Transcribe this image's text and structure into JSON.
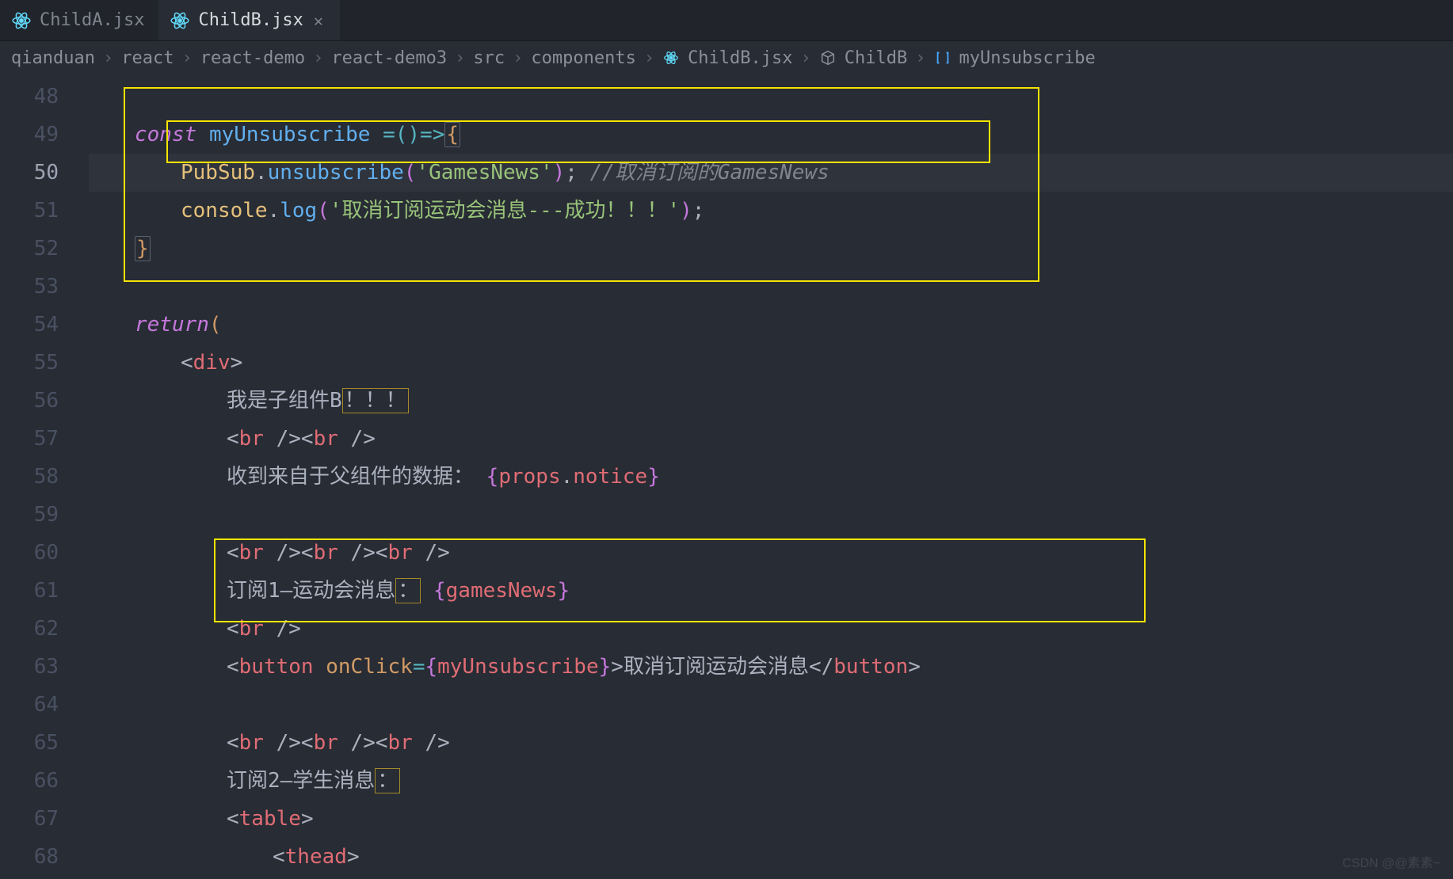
{
  "tabs": [
    {
      "label": "ChildA.jsx",
      "active": false
    },
    {
      "label": "ChildB.jsx",
      "active": true
    }
  ],
  "breadcrumbs": {
    "parts": [
      "qianduan",
      "react",
      "react-demo",
      "react-demo3",
      "src",
      "components"
    ],
    "file": "ChildB.jsx",
    "symbol1": "ChildB",
    "symbol2": "myUnsubscribe"
  },
  "gutter": {
    "start": 48,
    "end": 68,
    "current": 50
  },
  "code": {
    "l49_const": "const",
    "l49_name": "myUnsubscribe",
    "l49_arrow": "=()=>",
    "l50_obj": "PubSub",
    "l50_method": "unsubscribe",
    "l50_arg": "'GamesNews'",
    "l50_cmt": "//取消订阅的GamesNews",
    "l51_obj": "console",
    "l51_method": "log",
    "l51_arg": "'取消订阅运动会消息---成功！！！'",
    "l54_return": "return",
    "l55_tag": "div",
    "l56_text_a": "我是子组件B",
    "l56_text_b": "！！！",
    "l57_tag": "br",
    "l58_text": "收到来自于父组件的数据：",
    "l58_expr_a": "props",
    "l58_expr_b": "notice",
    "l60_tag": "br",
    "l61_text_a": "订阅1—运动会消息",
    "l61_text_b": "：",
    "l61_expr": "gamesNews",
    "l62_tag": "br",
    "l63_tag": "button",
    "l63_attr": "onClick",
    "l63_expr": "myUnsubscribe",
    "l63_inner": "取消订阅运动会消息",
    "l65_tag": "br",
    "l66_text_a": "订阅2—学生消息",
    "l66_text_b": "：",
    "l67_tag": "table",
    "l68_tag": "thead"
  },
  "watermark": "CSDN @@素素~"
}
